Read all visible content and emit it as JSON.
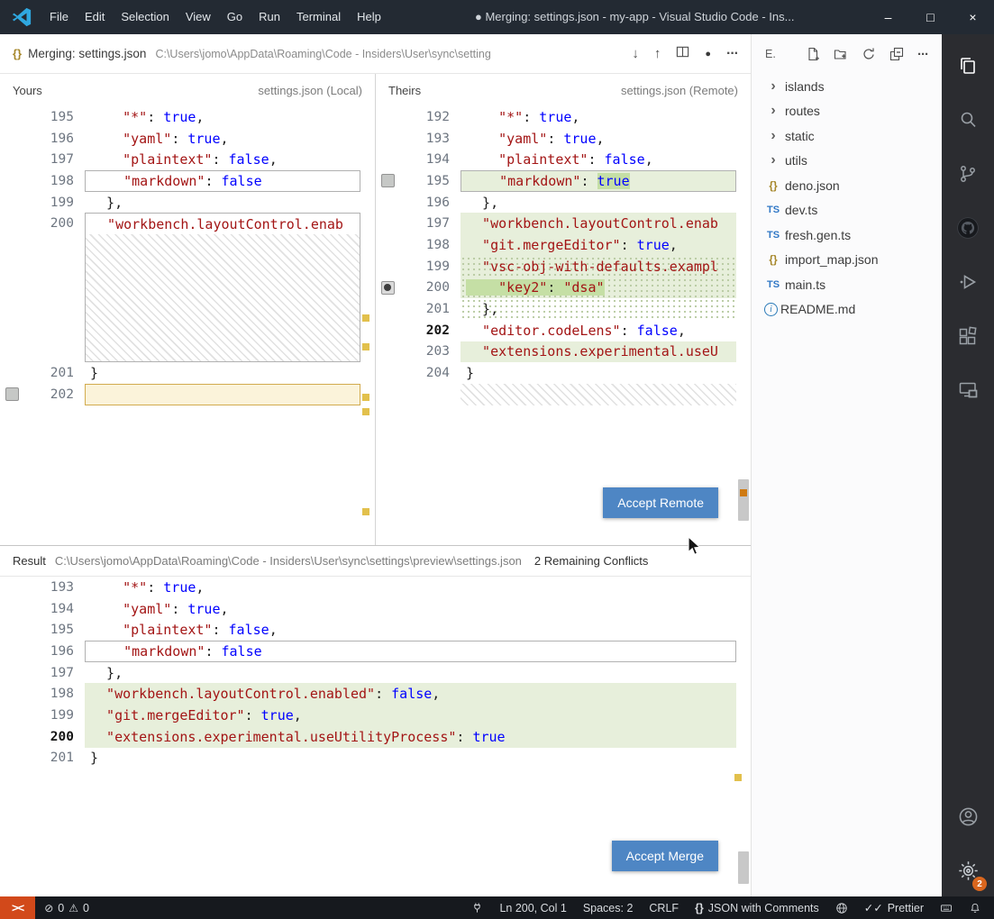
{
  "titlebar": {
    "menus": [
      "File",
      "Edit",
      "Selection",
      "View",
      "Go",
      "Run",
      "Terminal",
      "Help"
    ],
    "title": "● Merging: settings.json - my-app - Visual Studio Code - Ins..."
  },
  "tabbar": {
    "tab_label": "Merging: settings.json",
    "tab_path": "C:\\Users\\jomo\\AppData\\Roaming\\Code - Insiders\\User\\sync\\setting"
  },
  "merge": {
    "yours": {
      "title": "Yours",
      "subtitle": "settings.json (Local)",
      "lines": [
        {
          "n": 195,
          "t": [
            [
              "    \"*\"",
              "s"
            ],
            [
              ": ",
              "p"
            ],
            [
              "true",
              "b"
            ],
            [
              ",",
              "p"
            ]
          ]
        },
        {
          "n": 196,
          "t": [
            [
              "    \"yaml\"",
              "s"
            ],
            [
              ": ",
              "p"
            ],
            [
              "true",
              "b"
            ],
            [
              ",",
              "p"
            ]
          ]
        },
        {
          "n": 197,
          "t": [
            [
              "    \"plaintext\"",
              "s"
            ],
            [
              ": ",
              "p"
            ],
            [
              "false",
              "b"
            ],
            [
              ",",
              "p"
            ]
          ]
        },
        {
          "n": 198,
          "t": [
            [
              "    \"markdown\"",
              "s"
            ],
            [
              ": ",
              "p"
            ],
            [
              "false",
              "b"
            ]
          ],
          "box": "gray"
        },
        {
          "n": 199,
          "t": [
            [
              "  },",
              "p"
            ]
          ]
        },
        {
          "n": 200,
          "t": [
            [
              "  \"workbench.layoutControl.enab",
              "s"
            ]
          ],
          "box": "gray-open"
        },
        {
          "hatch": 6,
          "boxed": true
        },
        {
          "n": 201,
          "t": [
            [
              "}",
              "p"
            ]
          ]
        },
        {
          "n": 202,
          "t": [],
          "box": "yellow",
          "check": "off"
        }
      ]
    },
    "theirs": {
      "title": "Theirs",
      "subtitle": "settings.json (Remote)",
      "accept_button": "Accept Remote",
      "lines": [
        {
          "n": 192,
          "t": [
            [
              "    \"*\"",
              "s"
            ],
            [
              ": ",
              "p"
            ],
            [
              "true",
              "b"
            ],
            [
              ",",
              "p"
            ]
          ]
        },
        {
          "n": 193,
          "t": [
            [
              "    \"yaml\"",
              "s"
            ],
            [
              ": ",
              "p"
            ],
            [
              "true",
              "b"
            ],
            [
              ",",
              "p"
            ]
          ]
        },
        {
          "n": 194,
          "t": [
            [
              "    \"plaintext\"",
              "s"
            ],
            [
              ": ",
              "p"
            ],
            [
              "false",
              "b"
            ],
            [
              ",",
              "p"
            ]
          ]
        },
        {
          "n": 195,
          "t": [
            [
              "    \"markdown\"",
              "s"
            ],
            [
              ": ",
              "p"
            ],
            [
              "true",
              "b",
              1
            ]
          ],
          "bg": "green",
          "box": "gray",
          "check": "off"
        },
        {
          "n": 196,
          "t": [
            [
              "  },",
              "p"
            ]
          ]
        },
        {
          "n": 197,
          "t": [
            [
              "  \"workbench.layoutControl.enab",
              "s"
            ]
          ],
          "bg": "green"
        },
        {
          "n": 198,
          "t": [
            [
              "  \"git.mergeEditor\"",
              "s"
            ],
            [
              ": ",
              "p"
            ],
            [
              "true",
              "b"
            ],
            [
              ",",
              "p"
            ]
          ],
          "bg": "green"
        },
        {
          "n": 199,
          "t": [
            [
              "  \"vsc-obj-with-defaults.exampl",
              "s"
            ]
          ],
          "bg": "green",
          "dots": true
        },
        {
          "n": 200,
          "t": [
            [
              "    \"key2\"",
              "s",
              1
            ],
            [
              ": ",
              "p",
              1
            ],
            [
              "\"dsa\"",
              "s",
              1
            ]
          ],
          "bg": "green",
          "dots": true,
          "check": "on"
        },
        {
          "n": 201,
          "t": [
            [
              "  },",
              "p"
            ]
          ],
          "dots": true
        },
        {
          "n": 202,
          "t": [
            [
              "  \"editor.codeLens\"",
              "s"
            ],
            [
              ": ",
              "p"
            ],
            [
              "false",
              "b"
            ],
            [
              ",",
              "p"
            ]
          ],
          "active": true
        },
        {
          "n": 203,
          "t": [
            [
              "  \"extensions.experimental.useU",
              "s"
            ]
          ],
          "bg": "green"
        },
        {
          "n": 204,
          "t": [
            [
              "}",
              "p"
            ]
          ]
        },
        {
          "hatch": 1
        }
      ]
    },
    "result": {
      "title": "Result",
      "path": "C:\\Users\\jomo\\AppData\\Roaming\\Code - Insiders\\User\\sync\\settings\\preview\\settings.json",
      "conflicts_label": "2 Remaining Conflicts",
      "accept_button": "Accept Merge",
      "lines": [
        {
          "n": 193,
          "t": [
            [
              "    \"*\"",
              "s"
            ],
            [
              ": ",
              "p"
            ],
            [
              "true",
              "b"
            ],
            [
              ",",
              "p"
            ]
          ]
        },
        {
          "n": 194,
          "t": [
            [
              "    \"yaml\"",
              "s"
            ],
            [
              ": ",
              "p"
            ],
            [
              "true",
              "b"
            ],
            [
              ",",
              "p"
            ]
          ]
        },
        {
          "n": 195,
          "t": [
            [
              "    \"plaintext\"",
              "s"
            ],
            [
              ": ",
              "p"
            ],
            [
              "false",
              "b"
            ],
            [
              ",",
              "p"
            ]
          ]
        },
        {
          "n": 196,
          "t": [
            [
              "    \"markdown\"",
              "s"
            ],
            [
              ": ",
              "p"
            ],
            [
              "false",
              "b"
            ]
          ],
          "box": "gray"
        },
        {
          "n": 197,
          "t": [
            [
              "  },",
              "p"
            ]
          ]
        },
        {
          "n": 198,
          "t": [
            [
              "  \"workbench.layoutControl.enabled\"",
              "s"
            ],
            [
              ": ",
              "p"
            ],
            [
              "false",
              "b"
            ],
            [
              ",",
              "p"
            ]
          ],
          "bg": "green"
        },
        {
          "n": 199,
          "t": [
            [
              "  \"git.mergeEditor\"",
              "s"
            ],
            [
              ": ",
              "p"
            ],
            [
              "true",
              "b"
            ],
            [
              ",",
              "p"
            ]
          ],
          "bg": "green"
        },
        {
          "n": 200,
          "t": [
            [
              "  \"extensions.experimental.useUtilityProcess\"",
              "s"
            ],
            [
              ": ",
              "p"
            ],
            [
              "true",
              "b"
            ]
          ],
          "bg": "green",
          "active": true
        },
        {
          "n": 201,
          "t": [
            [
              "}",
              "p"
            ]
          ]
        }
      ]
    }
  },
  "explorer": {
    "title": "E.",
    "items": [
      {
        "label": "islands",
        "kind": "folder"
      },
      {
        "label": "routes",
        "kind": "folder"
      },
      {
        "label": "static",
        "kind": "folder"
      },
      {
        "label": "utils",
        "kind": "folder"
      },
      {
        "label": "deno.json",
        "kind": "json"
      },
      {
        "label": "dev.ts",
        "kind": "ts"
      },
      {
        "label": "fresh.gen.ts",
        "kind": "ts"
      },
      {
        "label": "import_map.json",
        "kind": "json"
      },
      {
        "label": "main.ts",
        "kind": "ts"
      },
      {
        "label": "README.md",
        "kind": "info"
      }
    ]
  },
  "activity": {
    "settings_badge": "2"
  },
  "statusbar": {
    "errors": "0",
    "warnings": "0",
    "ln_col": "Ln 200, Col 1",
    "spaces": "Spaces: 2",
    "eol": "CRLF",
    "language_icon": "{}",
    "language": "JSON with Comments",
    "prettier_check": "✓✓",
    "prettier": "Prettier"
  },
  "icons": {
    "chevron": "›",
    "ts": "TS",
    "json": "{}",
    "info": "i",
    "arrow_down": "↓",
    "arrow_up": "↑",
    "dirty_dot": "●",
    "more": "···",
    "remote": "><",
    "error": "⊘",
    "warning": "⚠",
    "minimize": "–",
    "maximize": "□",
    "close": "×"
  },
  "colors": {
    "titlebar_bg": "#232a33",
    "statusbar_bg": "#16191e",
    "activitybar_bg": "#2b2c30",
    "accent_blue": "#4e86c4",
    "merge_change_bg": "#e7efdb",
    "merge_word_bg": "#c5dfa5",
    "handled_yellow_bg": "#fbf3da",
    "handled_yellow_border": "#d2ab4e",
    "code_string": "#a31515",
    "code_keyword": "#0000ff",
    "remote_orange": "#d2491a",
    "badge_orange": "#d9661e",
    "json_icon": "#a6872a",
    "logo_blue": "#2fa8e0"
  }
}
